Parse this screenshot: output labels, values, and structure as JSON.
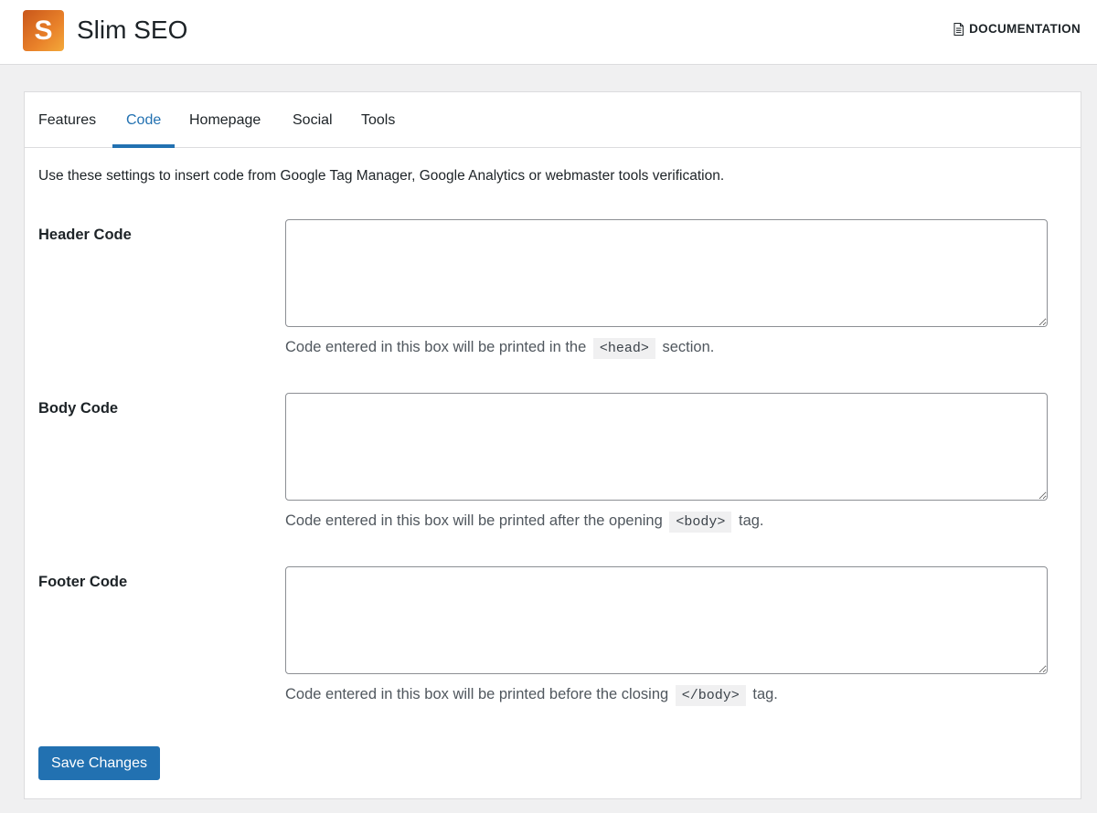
{
  "header": {
    "logo_letter": "S",
    "app_title": "Slim SEO",
    "doc_link": "DOCUMENTATION",
    "doc_icon": "document-icon"
  },
  "tabs": [
    {
      "label": "Features",
      "active": false
    },
    {
      "label": "Code",
      "active": true
    },
    {
      "label": "Homepage",
      "active": false
    },
    {
      "label": "Social",
      "active": false
    },
    {
      "label": "Tools",
      "active": false
    }
  ],
  "intro": "Use these settings to insert code from Google Tag Manager, Google Analytics or webmaster tools verification.",
  "fields": {
    "header": {
      "label": "Header Code",
      "value": "",
      "hint_before": "Code entered in this box will be printed in the",
      "hint_code": "<head>",
      "hint_after": "section."
    },
    "body": {
      "label": "Body Code",
      "value": "",
      "hint_before": "Code entered in this box will be printed after the opening",
      "hint_code": "<body>",
      "hint_after": "tag."
    },
    "footer": {
      "label": "Footer Code",
      "value": "",
      "hint_before": "Code entered in this box will be printed before the closing",
      "hint_code": "</body>",
      "hint_after": "tag."
    }
  },
  "save_button": "Save Changes",
  "colors": {
    "accent": "#2271b1",
    "background": "#f0f0f1",
    "logo_gradient": [
      "#c9561a",
      "#f3a93a"
    ]
  }
}
